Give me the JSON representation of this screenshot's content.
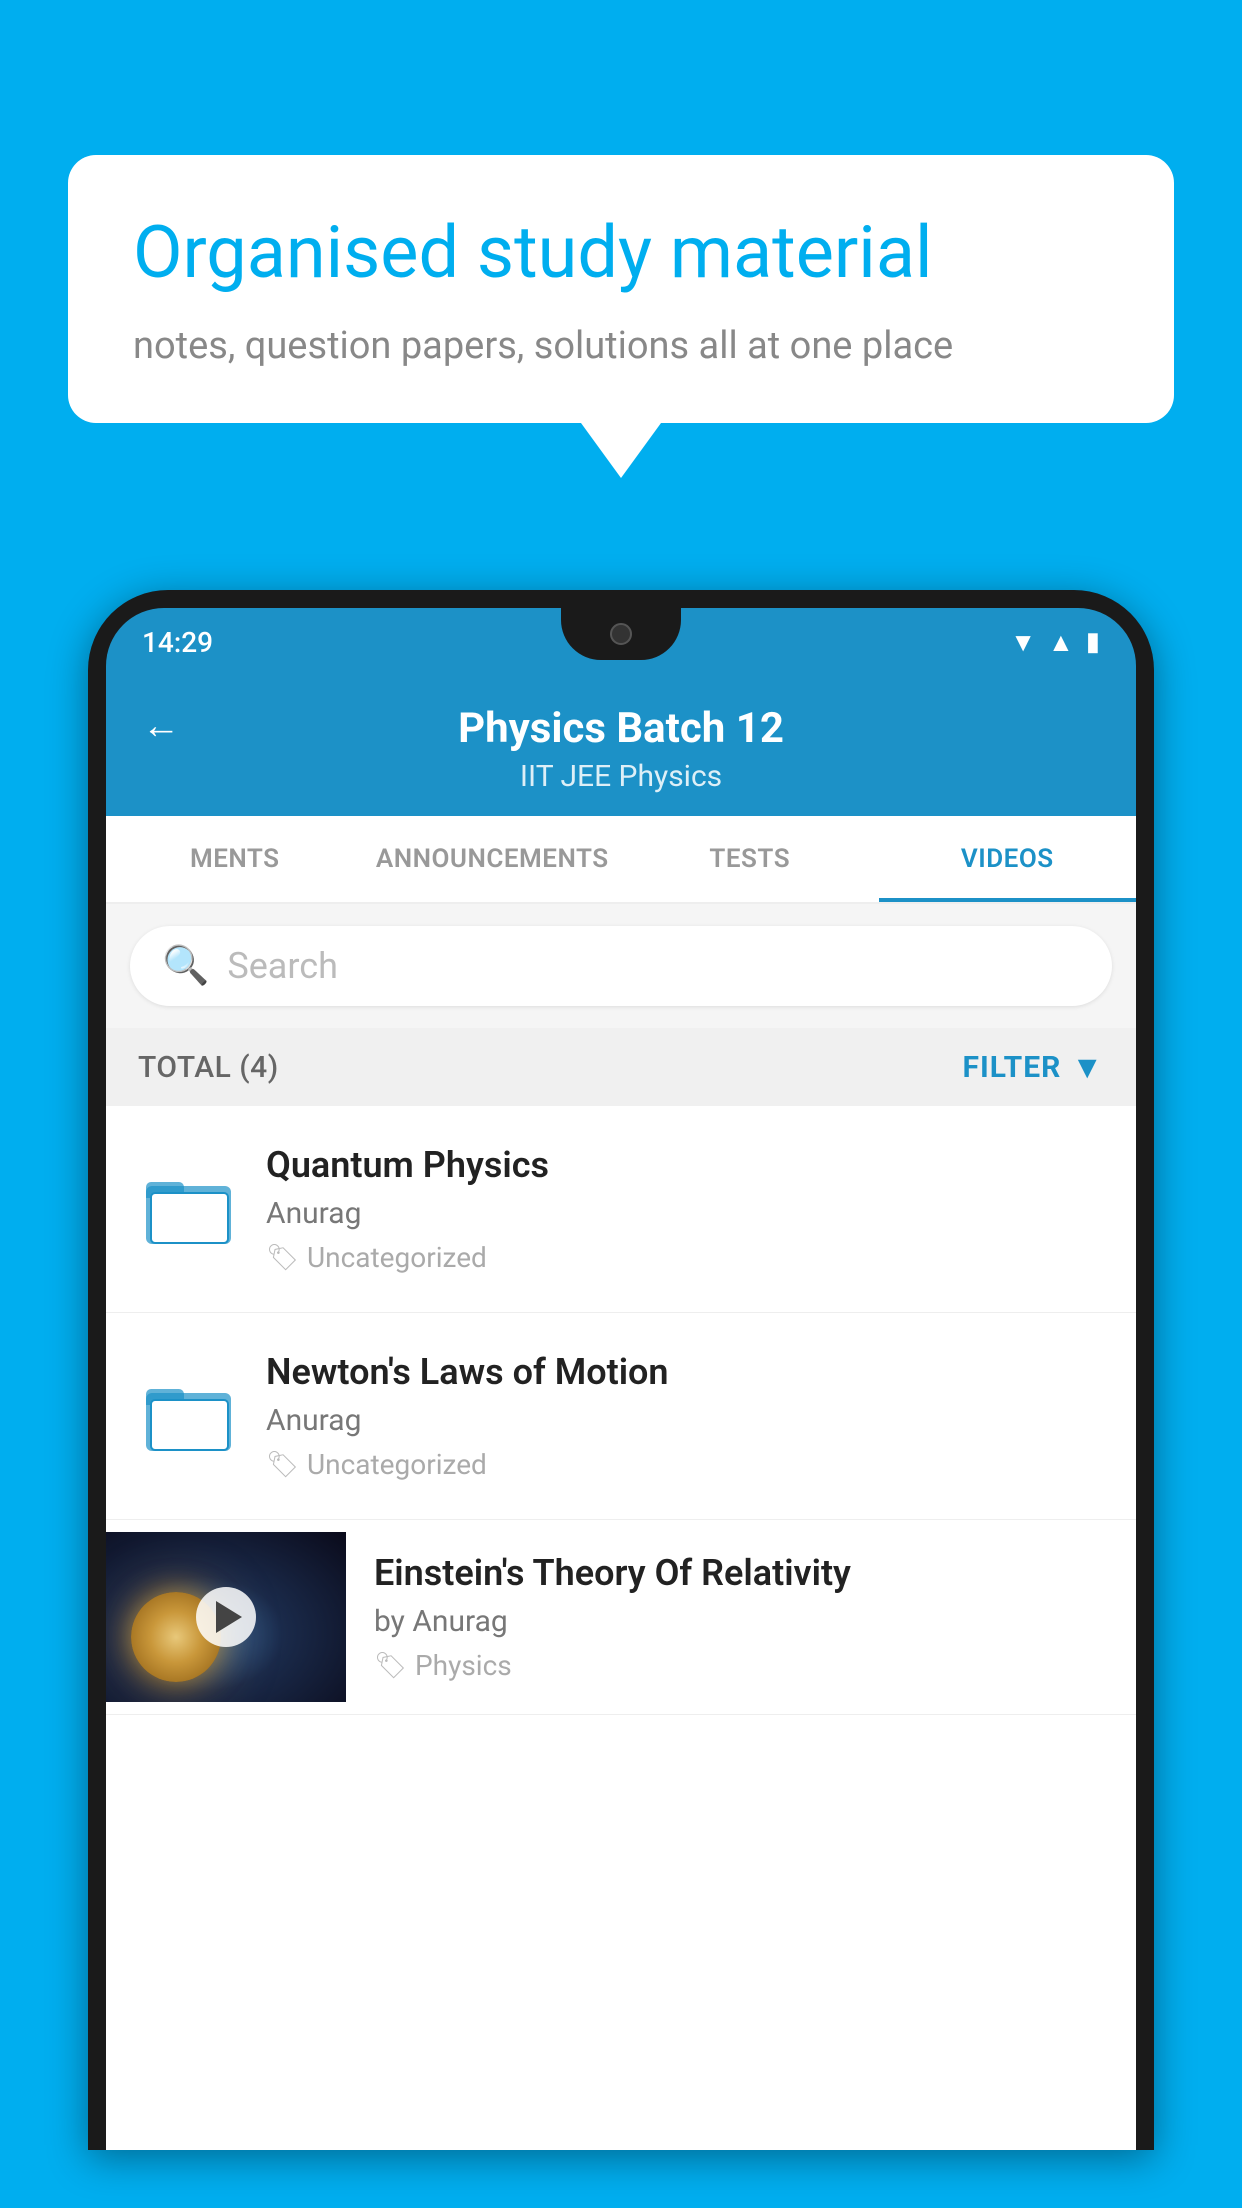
{
  "background_color": "#00AEEF",
  "speech_bubble": {
    "title": "Organised study material",
    "subtitle": "notes, question papers, solutions all at one place"
  },
  "phone": {
    "time": "14:29",
    "header": {
      "back_label": "←",
      "title": "Physics Batch 12",
      "subtitle": "IIT JEE   Physics"
    },
    "tabs": [
      {
        "label": "MENTS",
        "active": false
      },
      {
        "label": "ANNOUNCEMENTS",
        "active": false
      },
      {
        "label": "TESTS",
        "active": false
      },
      {
        "label": "VIDEOS",
        "active": true
      }
    ],
    "search": {
      "placeholder": "Search"
    },
    "filter": {
      "total_label": "TOTAL (4)",
      "filter_label": "FILTER"
    },
    "videos": [
      {
        "title": "Quantum Physics",
        "author": "Anurag",
        "tag": "Uncategorized",
        "has_thumbnail": false
      },
      {
        "title": "Newton's Laws of Motion",
        "author": "Anurag",
        "tag": "Uncategorized",
        "has_thumbnail": false
      },
      {
        "title": "Einstein's Theory Of Relativity",
        "author": "by Anurag",
        "tag": "Physics",
        "has_thumbnail": true
      }
    ]
  }
}
